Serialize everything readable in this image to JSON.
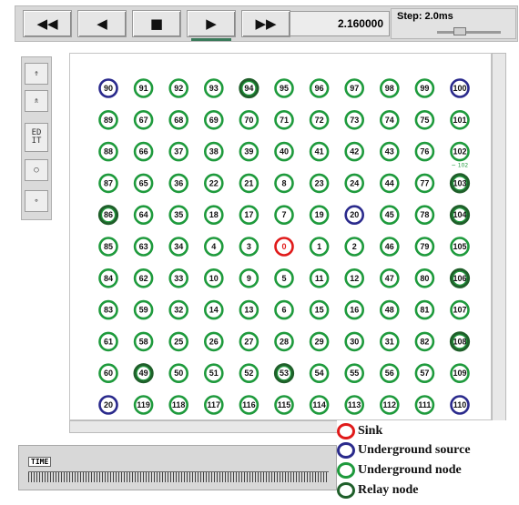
{
  "toolbar": {
    "buttons": [
      {
        "name": "rewind-button",
        "icon": "rewind-icon",
        "glyph": "◀◀"
      },
      {
        "name": "step-back-button",
        "icon": "play-backward-icon",
        "glyph": "◀"
      },
      {
        "name": "stop-button",
        "icon": "stop-icon",
        "glyph": "■"
      },
      {
        "name": "play-button",
        "icon": "play-icon",
        "glyph": "▶",
        "active": true
      },
      {
        "name": "fast-forward-button",
        "icon": "fast-forward-icon",
        "glyph": "▶▶"
      }
    ],
    "time_value": "2.160000",
    "step_label": "Step: 2.0ms"
  },
  "sidebar": {
    "buttons": [
      {
        "name": "zoom-in-button",
        "icon": "zoom-in-icon",
        "label": "⇮"
      },
      {
        "name": "zoom-out-button",
        "icon": "zoom-out-icon",
        "label": "⇯"
      },
      {
        "name": "edit-button",
        "icon": "edit-icon",
        "label": "ED\nIT"
      },
      {
        "name": "circle-large-button",
        "icon": "circle-icon",
        "label": "○"
      },
      {
        "name": "circle-small-button",
        "icon": "small-circle-icon",
        "label": "∘"
      }
    ]
  },
  "grid": {
    "rows": [
      [
        "90",
        "91",
        "92",
        "93",
        "94",
        "95",
        "96",
        "97",
        "98",
        "99",
        "100"
      ],
      [
        "89",
        "67",
        "68",
        "69",
        "70",
        "71",
        "72",
        "73",
        "74",
        "75",
        "101"
      ],
      [
        "88",
        "66",
        "37",
        "38",
        "39",
        "40",
        "41",
        "42",
        "43",
        "76",
        "102"
      ],
      [
        "87",
        "65",
        "36",
        "22",
        "21",
        "8",
        "23",
        "24",
        "44",
        "77",
        "103"
      ],
      [
        "86",
        "64",
        "35",
        "18",
        "17",
        "7",
        "19",
        "20",
        "45",
        "78",
        "104"
      ],
      [
        "85",
        "63",
        "34",
        "4",
        "3",
        "0",
        "1",
        "2",
        "46",
        "79",
        "105"
      ],
      [
        "84",
        "62",
        "33",
        "10",
        "9",
        "5",
        "11",
        "12",
        "47",
        "80",
        "106"
      ],
      [
        "83",
        "59",
        "32",
        "14",
        "13",
        "6",
        "15",
        "16",
        "48",
        "81",
        "107"
      ],
      [
        "61",
        "58",
        "25",
        "26",
        "27",
        "28",
        "29",
        "30",
        "31",
        "82",
        "108"
      ],
      [
        "60",
        "49",
        "50",
        "51",
        "52",
        "53",
        "54",
        "55",
        "56",
        "57",
        "109"
      ],
      [
        "20",
        "119",
        "118",
        "117",
        "116",
        "115",
        "114",
        "113",
        "112",
        "111",
        "110"
      ]
    ],
    "sink": "0",
    "sources": [
      "90",
      "100",
      "20",
      "110"
    ],
    "relays": [
      "94",
      "86",
      "104",
      "106",
      "108",
      "53",
      "103",
      "49"
    ],
    "annotation": "~ 102"
  },
  "colors": {
    "sink": "#e01a1a",
    "source": "#2a2a8c",
    "underground": "#1e9a3c",
    "relay": "#1f5f2a"
  },
  "timeline": {
    "label": "TIME"
  },
  "legend": {
    "items": [
      {
        "label": "Sink",
        "type": "sink"
      },
      {
        "label": "Underground source",
        "type": "source"
      },
      {
        "label": "Underground node",
        "type": "underground"
      },
      {
        "label": "Relay node",
        "type": "relay"
      }
    ]
  }
}
